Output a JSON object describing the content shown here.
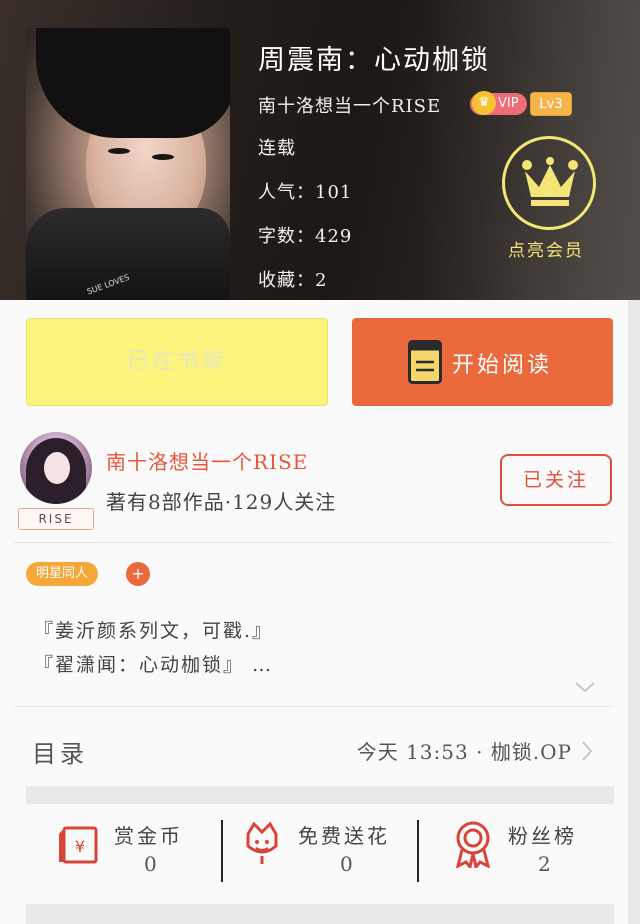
{
  "header": {
    "title": "周震南：心动枷锁",
    "author": "南十洛想当一个RISE",
    "vip_label": "VIP",
    "level": "Lv3",
    "status": "连载",
    "popularity": "人气：101",
    "word_count": "字数：429",
    "favorites": "收藏：2",
    "member_label": "点亮会员",
    "cover_shirt_text": "SUE LOVES"
  },
  "actions": {
    "shelf_label": "已在书架",
    "read_label": "开始阅读"
  },
  "author_card": {
    "name": "南十洛想当一个RISE",
    "summary": "著有8部作品·129人关注",
    "name_tag": "RISE",
    "follow_label": "已关注"
  },
  "tags": [
    "明星同人"
  ],
  "tag_add": "+",
  "intro": {
    "line1": "『姜沂颜系列文，可戳.』",
    "line2": "『翟潇闻：心动枷锁』 …"
  },
  "toc": {
    "label": "目录",
    "latest": "今天 13:53 · 枷锁.OP"
  },
  "stats": [
    {
      "label": "赏金币",
      "value": "0",
      "icon": "red-envelope-icon"
    },
    {
      "label": "免费送花",
      "value": "0",
      "icon": "flower-icon"
    },
    {
      "label": "粉丝榜",
      "value": "2",
      "icon": "medal-icon"
    }
  ],
  "colors": {
    "accent_orange": "#ea6a3e",
    "shelf_yellow": "#fbf37c",
    "author_red": "#e8563a",
    "icon_red": "#d9443a",
    "member_yellow": "#f3e676"
  }
}
